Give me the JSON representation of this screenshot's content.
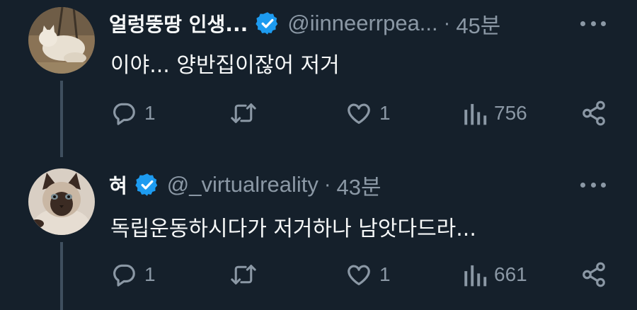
{
  "colors": {
    "background": "#15202b",
    "text_primary": "#f7f9f9",
    "text_secondary": "#8b98a5",
    "verified_badge": "#1d9bf0",
    "thread_line": "#3f4f5e"
  },
  "tweets": [
    {
      "display_name": "얼렁뚱땅 인생...",
      "handle": "@iinneerrpea...",
      "separator": "·",
      "timestamp": "45분",
      "text": "이야... 양반집이잖어 저거",
      "avatar_icon": "cat-avatar",
      "verified": true,
      "replies": "1",
      "retweets": "",
      "likes": "1",
      "views": "756"
    },
    {
      "display_name": "혀",
      "handle": "@_virtualreality",
      "separator": "·",
      "timestamp": "43분",
      "text": "독립운동하시다가 저거하나 남앗다드라...",
      "avatar_icon": "cat-avatar",
      "verified": true,
      "replies": "1",
      "retweets": "",
      "likes": "1",
      "views": "661"
    }
  ]
}
